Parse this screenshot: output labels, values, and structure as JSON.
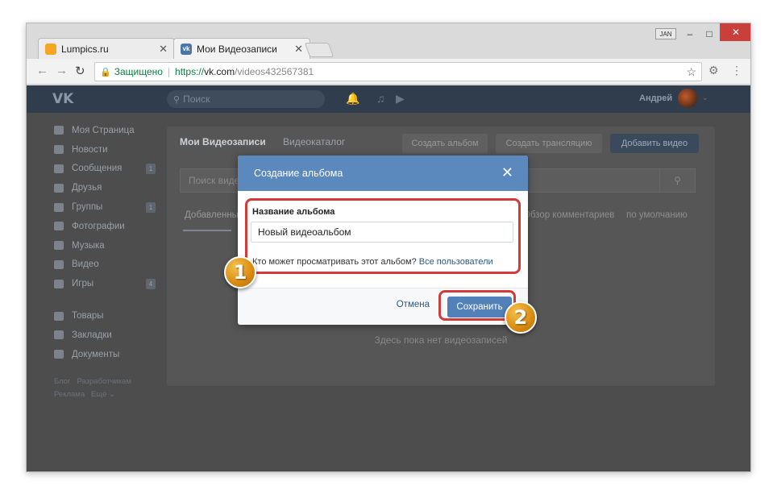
{
  "browser": {
    "tabs": [
      {
        "title": "Lumpics.ru",
        "favicon_color": "#f5a623"
      },
      {
        "title": "Мои Видеозаписи",
        "favicon_color": "#4a76a8"
      }
    ],
    "user_badge": "JAN",
    "window_controls": {
      "minimize": "–",
      "maximize": "□",
      "close": "✕"
    },
    "secure_label": "Защищено",
    "url": {
      "protocol": "https://",
      "host": "vk.com",
      "path": "/videos432567381"
    }
  },
  "vk": {
    "logo": "VK",
    "search_placeholder": "Поиск",
    "username": "Андрей",
    "sidebar": {
      "items": [
        {
          "label": "Моя Страница",
          "count": ""
        },
        {
          "label": "Новости",
          "count": ""
        },
        {
          "label": "Сообщения",
          "count": "1"
        },
        {
          "label": "Друзья",
          "count": ""
        },
        {
          "label": "Группы",
          "count": "1"
        },
        {
          "label": "Фотографии",
          "count": ""
        },
        {
          "label": "Музыка",
          "count": ""
        },
        {
          "label": "Видео",
          "count": ""
        },
        {
          "label": "Игры",
          "count": "4"
        }
      ],
      "items2": [
        {
          "label": "Товары"
        },
        {
          "label": "Закладки"
        },
        {
          "label": "Документы"
        }
      ],
      "footer": {
        "blog": "Блог",
        "developers": "Разработчикам",
        "ads": "Реклама",
        "more": "Ещё ⌄"
      }
    },
    "content": {
      "tabs": [
        "Мои Видеозаписи",
        "Видеокаталог"
      ],
      "buttons": {
        "create_album": "Создать альбом",
        "create_stream": "Создать трансляцию",
        "add_video": "Добавить видео"
      },
      "search_placeholder": "Поиск видео",
      "subtab_added": "Добавленные",
      "sort_comments": "Обзор комментариев",
      "sort_default": "по умолчанию",
      "empty_text": "Здесь пока нет видеозаписей"
    }
  },
  "modal": {
    "title": "Создание альбома",
    "field_label": "Название альбома",
    "field_value": "Новый видеоальбом",
    "privacy_text": "Кто может просматривать этот альбом?",
    "privacy_link": "Все пользователи",
    "cancel_label": "Отмена",
    "save_label": "Сохранить"
  },
  "annotations": {
    "marker1": "1",
    "marker2": "2"
  }
}
